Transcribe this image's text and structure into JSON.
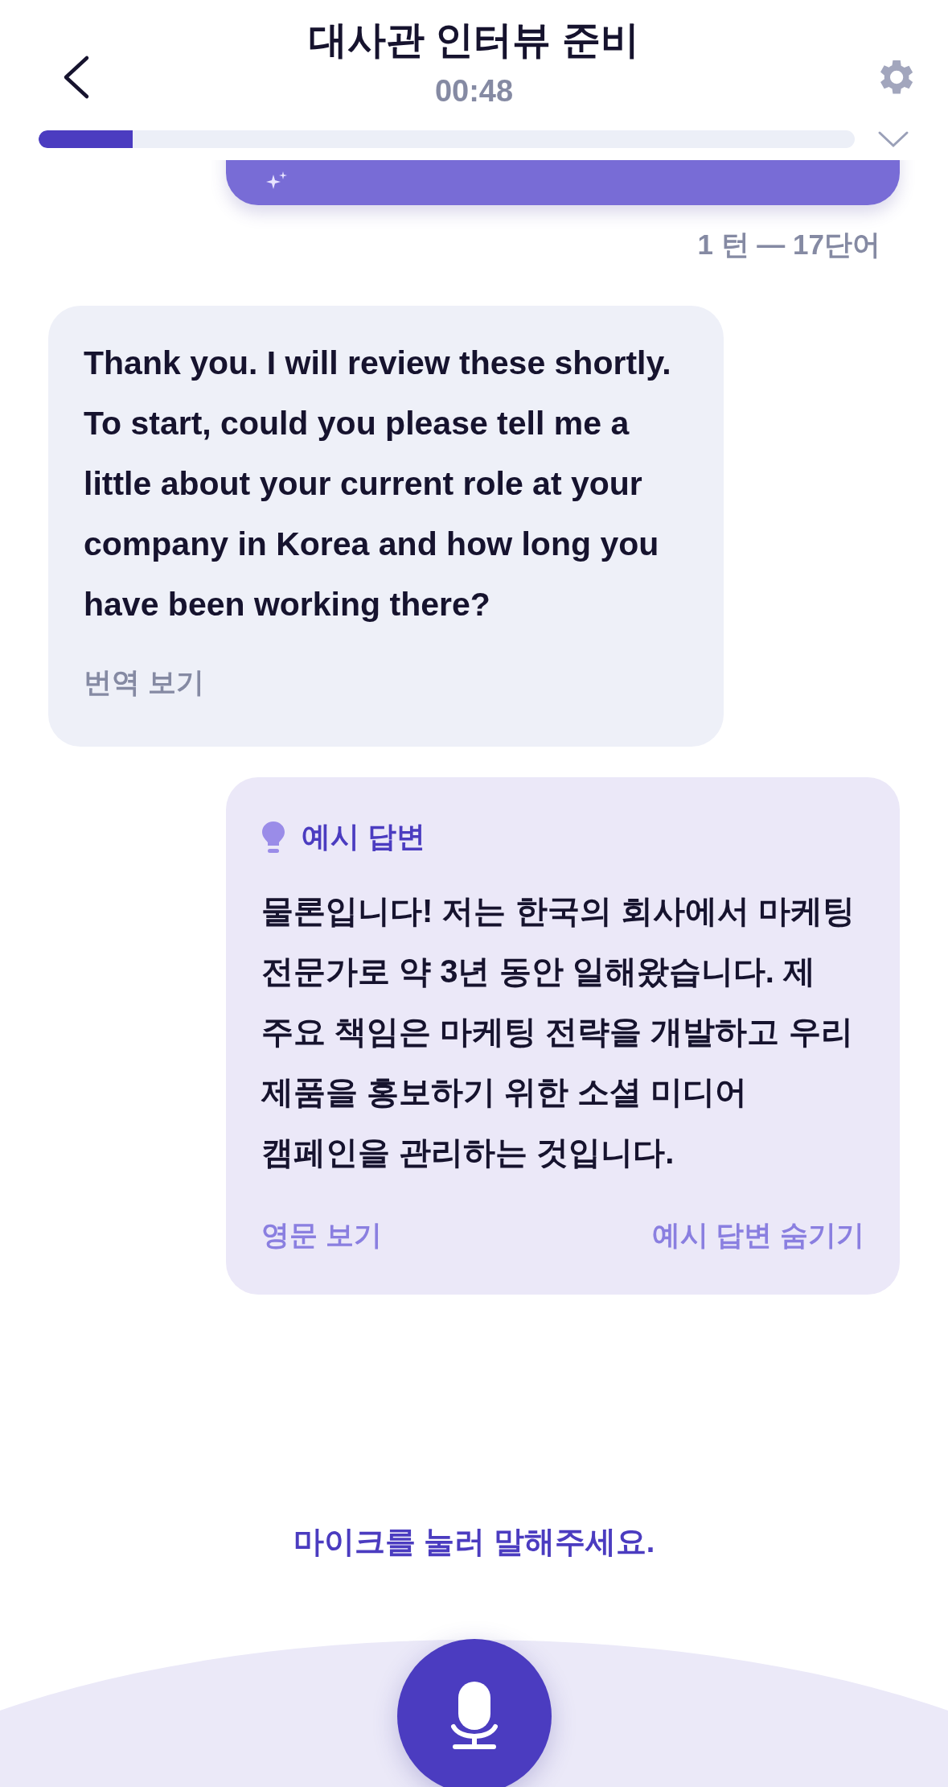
{
  "header": {
    "title": "대사관 인터뷰 준비",
    "timer": "00:48"
  },
  "progress": {
    "level": 0.115
  },
  "messages": [
    {
      "kind": "user"
    },
    {
      "kind": "meta",
      "text": "1 턴 — 17단어"
    },
    {
      "kind": "ai",
      "text": "Thank you. I will review these shortly. To start, could you please tell me a little about your current role at your company in Korea and how long you have been working there?",
      "action": "번역 보기"
    },
    {
      "kind": "example",
      "label": "예시 답변",
      "text": "물론입니다! 저는 한국의 회사에서 마케팅 전문가로 약 3년 동안 일해왔습니다. 제 주요 책임은 마케팅 전략을 개발하고 우리 제품을 홍보하기 위한 소셜 미디어 캠페인을 관리하는 것입니다.",
      "actions": [
        "영문 보기",
        "예시 답변 숨기기"
      ]
    }
  ],
  "prompt": "마이크를 눌러 말해주세요."
}
